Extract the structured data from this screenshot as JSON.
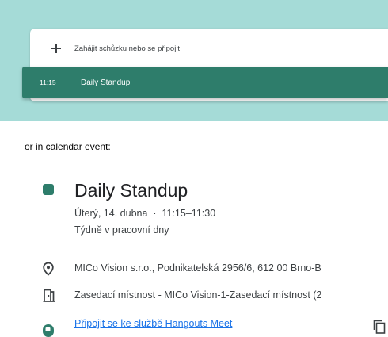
{
  "top_card": {
    "join_label": "Zahájit schůzku nebo se připojit",
    "event_time": "11:15",
    "event_name": "Daily Standup",
    "colors": {
      "panel_bg": "#a5dbd7",
      "event_bg": "#2e7d6b"
    }
  },
  "caption": "or in calendar event:",
  "event_details": {
    "title": "Daily Standup",
    "date": "Úterý, 14. dubna",
    "time": "11:15–11:30",
    "recurrence": "Týdně v pracovní dny",
    "location": "MICo Vision s.r.o., Podnikatelská 2956/6, 612 00 Brno-B",
    "room": "Zasedací místnost - MICo Vision-1-Zasedací místnost (2",
    "meet_link": "Připojit se ke službě Hangouts Meet",
    "icons": [
      "location-pin-icon",
      "room-icon",
      "hangouts-meet-icon",
      "copy-icon"
    ],
    "color": "#2e7d6b"
  }
}
